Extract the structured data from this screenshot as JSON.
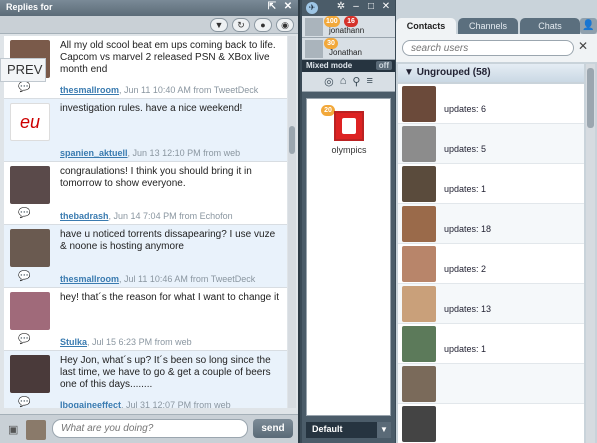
{
  "left": {
    "title": "Replies for",
    "prev_label": "PREV",
    "tweets": [
      {
        "text": "All my old scool beat em ups coming back to life. Capcom vs marvel 2 released PSN & XBox live month end",
        "user": "thesmallroom",
        "time": "Jun 11 10:40 AM from TweetDeck"
      },
      {
        "text": "investigation rules. have a nice weekend!",
        "user": "spanien_aktuell",
        "time": "Jun 13 12:10 PM from web"
      },
      {
        "text": "congraulations! I think you should bring it in tomorrow to show everyone.",
        "user": "thebadrash",
        "time": "Jun 14 7:04 PM from Echofon"
      },
      {
        "text": "have u noticed torrents dissapearing? I use vuze & noone is hosting anymore",
        "user": "thesmallroom",
        "time": "Jul 11 10:46 AM from TweetDeck"
      },
      {
        "text": "hey! that´s the reason for what I want to change it",
        "user": "Stulka",
        "time": "Jul 15 6:23 PM from web"
      },
      {
        "text": "Hey Jon, what´s up? It´s been so long since the last time, we have to go & get a couple of beers one of this days........",
        "user": "Ibogaineeffect",
        "time": "Jul 31 12:07 PM from web"
      }
    ],
    "composer_placeholder": "What are you doing?",
    "send_label": "send"
  },
  "mid": {
    "accounts": [
      {
        "name": "jonathann",
        "badge_a": "100",
        "badge_b": "16"
      },
      {
        "name": "Jonathan",
        "badge_a": "30"
      }
    ],
    "mode_label": "Mixed mode",
    "mode_state": "off",
    "group": {
      "label": "olympics",
      "badge": "20"
    },
    "footer_label": "Default"
  },
  "right": {
    "tabs": [
      "Contacts",
      "Channels",
      "Chats"
    ],
    "search_placeholder": "search users",
    "group_heading": "Ungrouped (58)",
    "contacts": [
      {
        "updates": "updates: 6",
        "color": "#6b4a3a"
      },
      {
        "updates": "updates: 5",
        "color": "#8c8c8c"
      },
      {
        "updates": "updates: 1",
        "color": "#5a4b3c"
      },
      {
        "updates": "updates: 18",
        "color": "#9a6a4a"
      },
      {
        "updates": "updates: 2",
        "color": "#b8856a"
      },
      {
        "updates": "updates: 13",
        "color": "#c9a07a"
      },
      {
        "updates": "updates: 1",
        "color": "#5c7a5a"
      },
      {
        "updates": "",
        "color": "#7a6a5a"
      },
      {
        "updates": "",
        "color": "#444444"
      }
    ]
  }
}
